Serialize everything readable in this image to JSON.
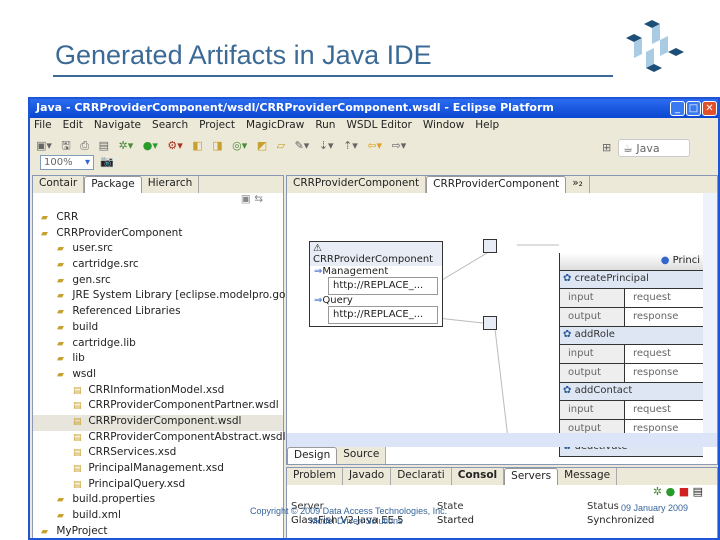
{
  "slide": {
    "title": "Generated Artifacts in Java IDE",
    "copyright": "Copyright © 2009 Data Access Technologies, Inc.",
    "subtitle": "Model Driven Solutions",
    "date": "09 January 2009"
  },
  "window": {
    "title": "Java - CRRProviderComponent/wsdl/CRRProviderComponent.wsdl - Eclipse Platform"
  },
  "menu": [
    "File",
    "Edit",
    "Navigate",
    "Search",
    "Project",
    "MagicDraw",
    "Run",
    "WSDL Editor",
    "Window",
    "Help"
  ],
  "toolbar": {
    "zoom": "100%",
    "perspective": "Java"
  },
  "left_tabs": [
    "Contair",
    "Package",
    "Hierarch"
  ],
  "tree": [
    {
      "label": "CRR",
      "depth": 0
    },
    {
      "label": "CRRProviderComponent",
      "depth": 0
    },
    {
      "label": "user.src",
      "depth": 1
    },
    {
      "label": "cartridge.src",
      "depth": 1
    },
    {
      "label": "gen.src",
      "depth": 1
    },
    {
      "label": "JRE System Library [eclipse.modelpro.go",
      "depth": 1
    },
    {
      "label": "Referenced Libraries",
      "depth": 1
    },
    {
      "label": "build",
      "depth": 1
    },
    {
      "label": "cartridge.lib",
      "depth": 1
    },
    {
      "label": "lib",
      "depth": 1
    },
    {
      "label": "wsdl",
      "depth": 1
    },
    {
      "label": "CRRInformationModel.xsd",
      "depth": 2
    },
    {
      "label": "CRRProviderComponentPartner.wsdl",
      "depth": 2
    },
    {
      "label": "CRRProviderComponent.wsdl",
      "depth": 2
    },
    {
      "label": "CRRProviderComponentAbstract.wsdl",
      "depth": 2
    },
    {
      "label": "CRRServices.xsd",
      "depth": 2
    },
    {
      "label": "PrincipalManagement.xsd",
      "depth": 2
    },
    {
      "label": "PrincipalQuery.xsd",
      "depth": 2
    },
    {
      "label": "build.properties",
      "depth": 1
    },
    {
      "label": "build.xml",
      "depth": 1
    },
    {
      "label": "MyProject",
      "depth": 0
    }
  ],
  "editor_tabs": [
    "CRRProviderComponent",
    "CRRProviderComponent",
    "»₂"
  ],
  "diagram": {
    "service": "CRRProviderComponent",
    "ports": [
      {
        "name": "Management",
        "address": "http://REPLACE_..."
      },
      {
        "name": "Query",
        "address": "http://REPLACE_..."
      }
    ],
    "binding_title": "Princi",
    "operations": [
      {
        "name": "createPrincipal",
        "input": "input",
        "output": "output",
        "request": "request",
        "response": "response"
      },
      {
        "name": "addRole",
        "input": "input",
        "output": "output",
        "request": "request",
        "response": "response"
      },
      {
        "name": "addContact",
        "input": "input",
        "output": "output",
        "request": "request",
        "response": "response"
      },
      {
        "name": "deactivate"
      }
    ]
  },
  "editor_bottom_tabs": [
    "Design",
    "Source"
  ],
  "bottom_tabs": [
    "Problem",
    "Javado",
    "Declarati",
    "Consol",
    "Servers",
    "Message"
  ],
  "servers": {
    "columns": [
      "Server",
      "State",
      "Status"
    ],
    "rows": [
      {
        "server": "GlassFish V2 Java EE 5",
        "state": "Started",
        "status": "Synchronized"
      }
    ]
  }
}
